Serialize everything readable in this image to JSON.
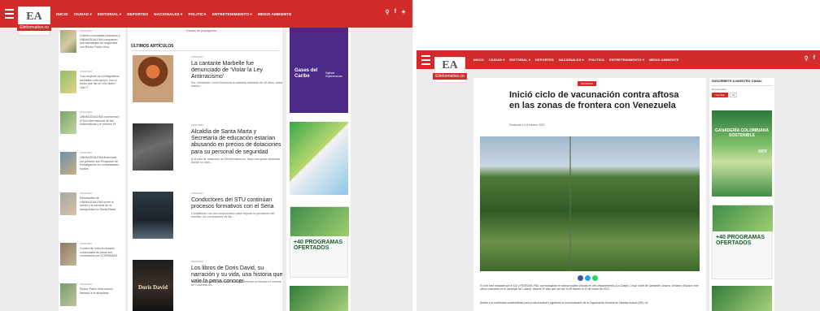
{
  "nav": {
    "items": [
      "INICIO",
      "CIUDAD",
      "EDITORIAL",
      "DEPORTES",
      "NACIONALES",
      "POLITICA",
      "ENTRETENIMIENTO",
      "MEDIO AMBIENTE"
    ],
    "dropdown_marker": "▾"
  },
  "logo": {
    "mark": "EA",
    "tag": "Elinformativo.co"
  },
  "left": {
    "top_fragment": "Estadio de propaganda",
    "section_title": "ÚLTIMOS ARTÍCULOS",
    "sidebar": [
      {
        "date": "15/01/2022",
        "text": "Líderes comunales pescanos y UNIMAGDALENA comparten sus estrategias de seguridad con Rector Pablo Vera"
      },
      {
        "date": "15/01/2022",
        "text": "“Las mujeres en el Magdalena necesitan más apoyo, con el techo que las un reto diario”: HALIT"
      },
      {
        "date": "15/01/2022",
        "text": "UNIMAGDALENA conmemoró el Día Internacional de las Matemáticas y el número Pi"
      },
      {
        "date": "15/01/2022",
        "text": "UNIMAGDALENA financiará por primera vez Proyectos de investigación en comunidades rurales"
      },
      {
        "date": "15/01/2022",
        "text": "Estudiantes de UNIMAGDALENA viven el miedo y la zozobra de la inseguridad en Santa Marta"
      },
      {
        "date": "15/01/2022",
        "text": "Control de ruido en locales comerciales de pisos son controlados por CORPAMAG"
      },
      {
        "date": "15/01/2022",
        "text": "Rector Pablo Vera estuvo llamado a la alcaldesa"
      }
    ],
    "articles": [
      {
        "date": "15/01/2022",
        "title": "La cantante Marbelle fue denunciado de ‘Violar la Ley Antirracismo’",
        "meta": "Por: Alexander Lerch   Denuncia la cantante Marbelle de 42 años, sellla realizó..."
      },
      {
        "date": "15/01/2022",
        "title": "Alcaldía de Santa Marta y Secretaría de educación estarían abusando en precios de dotaciones para su personal de seguridad",
        "meta": "A la sala de redacción de ElInformativo.co, llegó una grave denuncia, donde se infor..."
      },
      {
        "date": "15/01/2022",
        "title": "Conductores del STU continúan procesos formativos con el Sena",
        "meta": "Cumpliendo con los compromisos para mejorar la prestación del servicio, los conductores de las..."
      },
      {
        "date": "15/01/2022",
        "title": "Los libros de Doris David, su narración y su vida, una historia que vale la pena conocer",
        "meta": "Por: Yamile Gómez                 Un escritor o magdalenense se llevado el nombre de Colombia en..."
      }
    ],
    "book_cover": "Doris David",
    "ads": {
      "gases": "Gases del Caribe",
      "vigilado": "Vigilado Superservicios",
      "programas": "+40 PROGRAMAS OFERTADOS"
    }
  },
  "right": {
    "badge": "NACIONAL",
    "headline": "Inició ciclo de vacunación contra aftosa en las zonas de frontera con Venezuela",
    "date": "Publicado el 14 febrero 2022",
    "caption": "El ciclo será realizado por el ICA y FEDEGÁN-FNG, que trabajarán en alianza público privada en seis departamentos (La Guajira, Cesar, Norte de Santander, Arauca, Vichada y Boyacá -este último solamente en el municipio de Cubará), durante 30 días que van del 14 de febrero al 15 de marzo de 2022.",
    "body": "Debido a la confirmada vulnerabilidad para la salud animal y siguiendo la recomendación de la Organización Mundial de Sanidad Animal (OIE), se",
    "sidebar_title": "SUSCRÍBETE A NUESTRO CANAL",
    "channel_name": "El Informativo",
    "subscribe_label": "YouTube",
    "subscriber_count": "3K",
    "ad_sostenible": "GANADERÍA COLOMBIANA SOSTENIBLE",
    "ad_hoy": "HOY",
    "programas": "+40 PROGRAMAS OFERTADOS"
  }
}
